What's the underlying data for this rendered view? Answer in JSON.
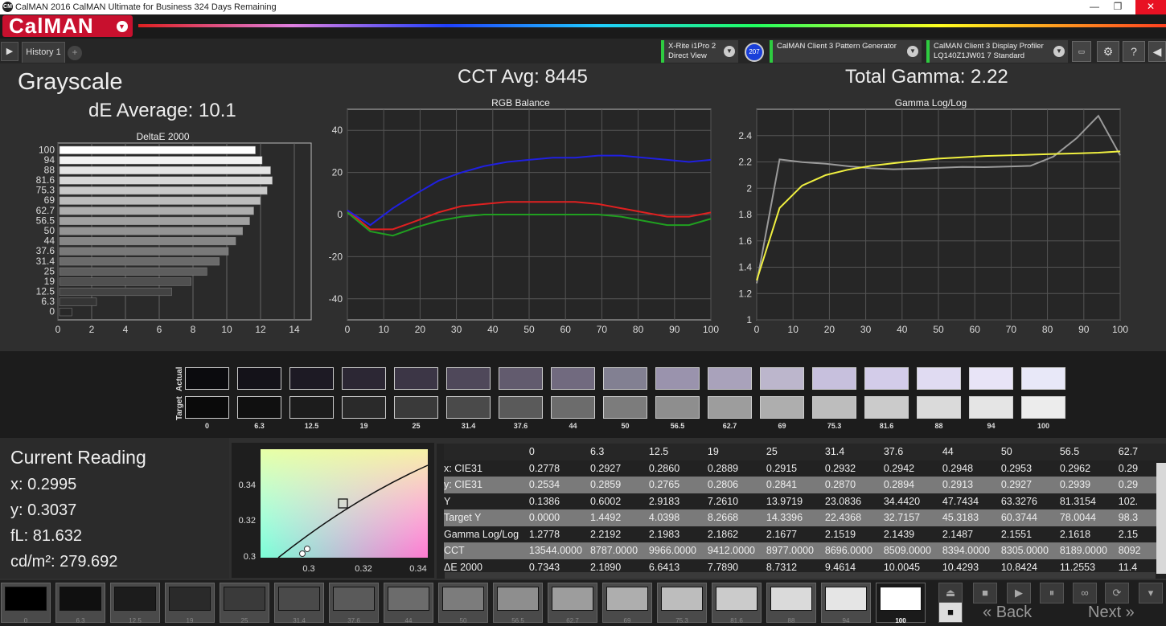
{
  "window": {
    "title": "CalMAN 2016 CalMAN Ultimate for Business 324 Days Remaining",
    "logo": "CM",
    "min": "—",
    "restore": "❐",
    "close": "✕"
  },
  "brand": {
    "name": "CalMAN",
    "color": "#c8102e"
  },
  "toolbar": {
    "history_tab": "History 1",
    "add_tab": "+",
    "play": "▶",
    "devices": [
      {
        "line1": "X-Rite i1Pro 2",
        "line2": "Direct View"
      },
      {
        "line1": "CalMAN Client 3 Pattern Generator",
        "line2": ""
      },
      {
        "line1": "CalMAN Client 3 Display Profiler",
        "line2": "LQ140Z1JW01 7 Standard"
      }
    ],
    "badge": "207",
    "icons": [
      "monitor-icon",
      "gear-icon",
      "help-icon",
      "back-arrow-icon"
    ]
  },
  "grayscale": {
    "title": "Grayscale",
    "de_average": "dE Average: 10.1"
  },
  "cct_avg": "CCT Avg: 8445",
  "total_gamma": "Total Gamma: 2.22",
  "chart_data": [
    {
      "type": "bar",
      "title": "DeltaE 2000",
      "orientation": "horizontal",
      "categories": [
        "0",
        "6.3",
        "12.5",
        "19",
        "25",
        "31.4",
        "37.6",
        "44",
        "50",
        "56.5",
        "62.7",
        "69",
        "75.3",
        "81.6",
        "88",
        "94",
        "100"
      ],
      "values": [
        0.73,
        2.19,
        6.64,
        7.79,
        8.73,
        9.46,
        10.0,
        10.43,
        10.84,
        11.26,
        11.5,
        11.9,
        12.3,
        12.6,
        12.5,
        12.0,
        11.6
      ],
      "xlim": [
        0,
        15
      ],
      "xticks": [
        0,
        2,
        4,
        6,
        8,
        10,
        12,
        14
      ],
      "ytick_labels": [
        "0",
        "6.3",
        "12.5",
        "19",
        "25",
        "31.4",
        "37.6",
        "44",
        "50",
        "56.5",
        "62.7",
        "69",
        "75.3",
        "81.6",
        "88",
        "94",
        "100"
      ]
    },
    {
      "type": "line",
      "title": "RGB Balance",
      "x": [
        0,
        6.3,
        12.5,
        19,
        25,
        31.4,
        37.6,
        44,
        50,
        56.5,
        62.7,
        69,
        75.3,
        81.6,
        88,
        94,
        100
      ],
      "xticks": [
        0,
        10,
        20,
        30,
        40,
        50,
        60,
        70,
        80,
        90,
        100
      ],
      "ylim": [
        -50,
        50
      ],
      "yticks": [
        40,
        20,
        0,
        -20,
        -40
      ],
      "series": [
        {
          "color": "#e02020",
          "values": [
            2,
            -7,
            -7,
            -3,
            1,
            4,
            5,
            6,
            6,
            6,
            6,
            5,
            3,
            1,
            -1,
            -1,
            1
          ]
        },
        {
          "color": "#20a020",
          "values": [
            1,
            -8,
            -10,
            -6,
            -3,
            -1,
            0,
            0,
            0,
            0,
            0,
            0,
            -1,
            -3,
            -5,
            -5,
            -2
          ]
        },
        {
          "color": "#2020e0",
          "values": [
            2,
            -5,
            3,
            10,
            16,
            20,
            23,
            25,
            26,
            27,
            27,
            28,
            28,
            27,
            26,
            25,
            26
          ]
        }
      ]
    },
    {
      "type": "line",
      "title": "Gamma Log/Log",
      "x": [
        0,
        6.3,
        12.5,
        19,
        25,
        31.4,
        37.6,
        44,
        50,
        56.5,
        62.7,
        69,
        75.3,
        81.6,
        88,
        94,
        100
      ],
      "xticks": [
        0,
        10,
        20,
        30,
        40,
        50,
        60,
        70,
        80,
        90,
        100
      ],
      "ylim": [
        1,
        2.6
      ],
      "yticks": [
        2.4,
        2.2,
        2,
        1.8,
        1.6,
        1.4,
        1.2,
        1
      ],
      "series": [
        {
          "color": "#9a9a9a",
          "values": [
            1.2778,
            2.2192,
            2.1983,
            2.1862,
            2.1677,
            2.1519,
            2.1439,
            2.1487,
            2.1551,
            2.1618,
            2.16,
            2.165,
            2.17,
            2.24,
            2.38,
            2.55,
            2.25
          ]
        },
        {
          "color": "#f0f040",
          "values": [
            1.3,
            1.85,
            2.02,
            2.1,
            2.14,
            2.17,
            2.19,
            2.21,
            2.225,
            2.235,
            2.245,
            2.25,
            2.255,
            2.26,
            2.265,
            2.27,
            2.28
          ]
        }
      ]
    }
  ],
  "swatches": {
    "actual_label": "Actual",
    "target_label": "Target",
    "labels": [
      "0",
      "6.3",
      "12.5",
      "19",
      "25",
      "31.4",
      "37.6",
      "44",
      "50",
      "56.5",
      "62.7",
      "69",
      "75.3",
      "81.6",
      "88",
      "94",
      "100"
    ],
    "actual_colors": [
      "#0b0b0e",
      "#141219",
      "#1d1a24",
      "#2c2734",
      "#3c3646",
      "#4f485a",
      "#625b6e",
      "#716a7f",
      "#828092",
      "#9a93ad",
      "#a9a2bb",
      "#bcb6cc",
      "#c7c0dd",
      "#d3cce9",
      "#e0dbf2",
      "#e8e4f7",
      "#e8e8f8"
    ],
    "target_colors": [
      "#0a0a0a",
      "#101010",
      "#1c1c1c",
      "#2a2a2a",
      "#3a3a3a",
      "#4a4a4a",
      "#5a5a5a",
      "#6c6c6c",
      "#7c7c7c",
      "#8e8e8e",
      "#9d9d9d",
      "#aeaeae",
      "#bdbdbd",
      "#cbcbcb",
      "#dadada",
      "#e5e5e5",
      "#ececec"
    ]
  },
  "current_reading": {
    "heading": "Current Reading",
    "x": "x: 0.2995",
    "y": "y: 0.3037",
    "fl": "fL: 81.632",
    "cdm2": "cd/m²: 279.692"
  },
  "cie_chart": {
    "yticks": [
      "0.34",
      "0.32",
      "0.3"
    ],
    "xticks": [
      "0.3",
      "0.32",
      "0.34"
    ]
  },
  "table": {
    "columns": [
      "0",
      "6.3",
      "12.5",
      "19",
      "25",
      "31.4",
      "37.6",
      "44",
      "50",
      "56.5",
      "62.7"
    ],
    "rows": [
      {
        "label": "x: CIE31",
        "cells": [
          "0.2778",
          "0.2927",
          "0.2860",
          "0.2889",
          "0.2915",
          "0.2932",
          "0.2942",
          "0.2948",
          "0.2953",
          "0.2962",
          "0.29"
        ]
      },
      {
        "label": "y: CIE31",
        "cells": [
          "0.2534",
          "0.2859",
          "0.2765",
          "0.2806",
          "0.2841",
          "0.2870",
          "0.2894",
          "0.2913",
          "0.2927",
          "0.2939",
          "0.29"
        ]
      },
      {
        "label": "Y",
        "cells": [
          "0.1386",
          "0.6002",
          "2.9183",
          "7.2610",
          "13.9719",
          "23.0836",
          "34.4420",
          "47.7434",
          "63.3276",
          "81.3154",
          "102."
        ]
      },
      {
        "label": "Target Y",
        "cells": [
          "0.0000",
          "1.4492",
          "4.0398",
          "8.2668",
          "14.3396",
          "22.4368",
          "32.7157",
          "45.3183",
          "60.3744",
          "78.0044",
          "98.3"
        ]
      },
      {
        "label": "Gamma Log/Log",
        "cells": [
          "1.2778",
          "2.2192",
          "2.1983",
          "2.1862",
          "2.1677",
          "2.1519",
          "2.1439",
          "2.1487",
          "2.1551",
          "2.1618",
          "2.15"
        ]
      },
      {
        "label": "CCT",
        "cells": [
          "13544.0000",
          "8787.0000",
          "9966.0000",
          "9412.0000",
          "8977.0000",
          "8696.0000",
          "8509.0000",
          "8394.0000",
          "8305.0000",
          "8189.0000",
          "8092"
        ]
      },
      {
        "label": "ΔE 2000",
        "cells": [
          "0.7343",
          "2.1890",
          "6.6413",
          "7.7890",
          "8.7312",
          "9.4614",
          "10.0045",
          "10.4293",
          "10.8424",
          "11.2553",
          "11.4"
        ]
      }
    ]
  },
  "bottom": {
    "labels": [
      "0",
      "6.3",
      "12.5",
      "19",
      "25",
      "31.4",
      "37.6",
      "44",
      "50",
      "56.5",
      "62.7",
      "69",
      "75.3",
      "81.6",
      "88",
      "94",
      "100"
    ],
    "colors": [
      "#000000",
      "#101010",
      "#1c1c1c",
      "#2a2a2a",
      "#3a3a3a",
      "#4a4a4a",
      "#5a5a5a",
      "#6c6c6c",
      "#7c7c7c",
      "#8e8e8e",
      "#9d9d9d",
      "#aeaeae",
      "#bdbdbd",
      "#cbcbcb",
      "#dadada",
      "#e5e5e5",
      "#ffffff"
    ],
    "back": "Back",
    "next": "Next"
  }
}
